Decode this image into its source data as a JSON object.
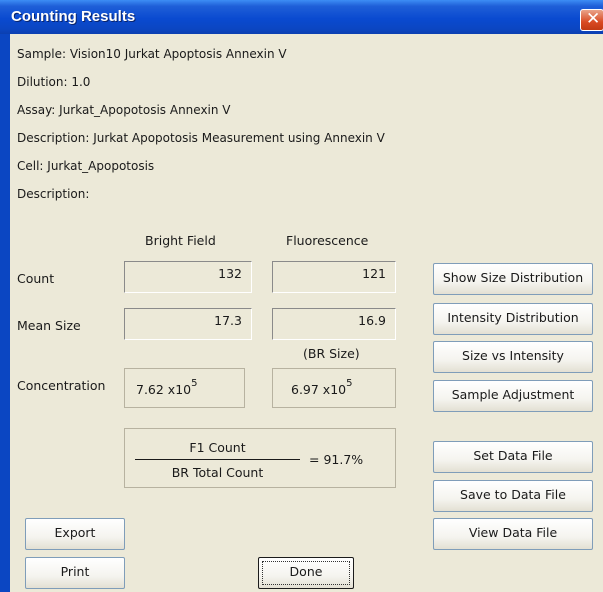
{
  "window": {
    "title": "Counting Results"
  },
  "info": {
    "sample": "Sample: Vision10 Jurkat Apoptosis Annexin V",
    "dilution": "Dilution: 1.0",
    "assay": "Assay: Jurkat_Apopotosis Annexin V",
    "description": "Description: Jurkat Apopotosis Measurement using Annexin V",
    "cell": "Cell: Jurkat_Apopotosis",
    "description2": "Description:"
  },
  "columns": {
    "bright_field": "Bright Field",
    "fluorescence": "Fluorescence"
  },
  "rows": {
    "count_label": "Count",
    "mean_size_label": "Mean Size",
    "concentration_label": "Concentration",
    "br_size_label": "(BR Size)"
  },
  "values": {
    "count_bf": "132",
    "count_fl": "121",
    "mean_bf": "17.3",
    "mean_fl": "16.9",
    "conc_bf_base": "7.62 x10",
    "conc_bf_exp": "5",
    "conc_fl_base": "6.97 x10",
    "conc_fl_exp": "5"
  },
  "ratio": {
    "numerator": "F1 Count",
    "denominator": "BR Total Count",
    "result": "= 91.7%"
  },
  "buttons": {
    "show_size_distribution": "Show Size Distribution",
    "intensity_distribution": "Intensity Distribution",
    "size_vs_intensity": "Size vs Intensity",
    "sample_adjustment": "Sample Adjustment",
    "set_data_file": "Set Data File",
    "save_to_data_file": "Save to Data File",
    "view_data_file": "View Data File",
    "export": "Export",
    "print": "Print",
    "done": "Done"
  }
}
